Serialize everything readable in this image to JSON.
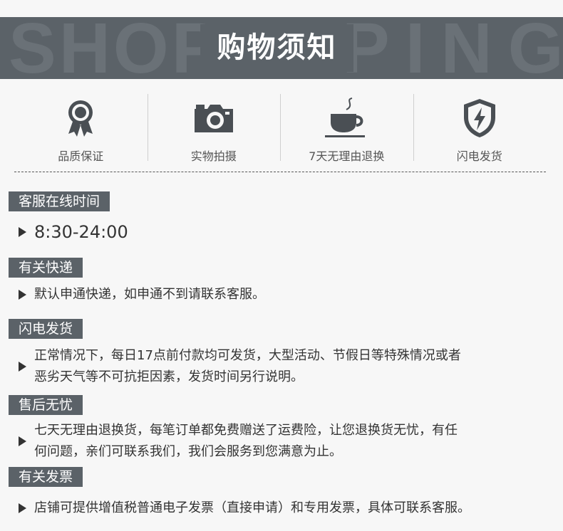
{
  "banner": {
    "watermark_left": "SHOP",
    "watermark_right": "PING",
    "title": "购物须知"
  },
  "features": [
    {
      "icon": "ribbon-medal-icon",
      "label": "品质保证"
    },
    {
      "icon": "camera-icon",
      "label": "实物拍摄"
    },
    {
      "icon": "coffee-cup-icon",
      "label": "7天无理由退换"
    },
    {
      "icon": "lightning-shield-icon",
      "label": "闪电发货"
    }
  ],
  "sections": [
    {
      "title": "客服在线时间",
      "text": "8:30-24:00"
    },
    {
      "title": "有关快递",
      "text": "默认申通快递，如申通不到请联系客服。"
    },
    {
      "title": "闪电发货",
      "line1": "正常情况下，每日17点前付款均可发货，大型活动、节假日等特殊情况或者",
      "line2": "恶劣天气等不可抗拒因素，发货时间另行说明。"
    },
    {
      "title": "售后无忧",
      "line1": "七天无理由退换货，每笔订单都免费赠送了运费险，让您退换货无忧，有任",
      "line2": "何问题，亲们可联系我们，我们会服务到您满意为止。"
    },
    {
      "title": "有关发票",
      "text": "店铺可提供增值税普通电子发票（直接申请）和专用发票，具体可联系客服。"
    }
  ],
  "colors": {
    "banner": "#5b6268",
    "text": "#333333",
    "background": "#f7f7f7"
  }
}
